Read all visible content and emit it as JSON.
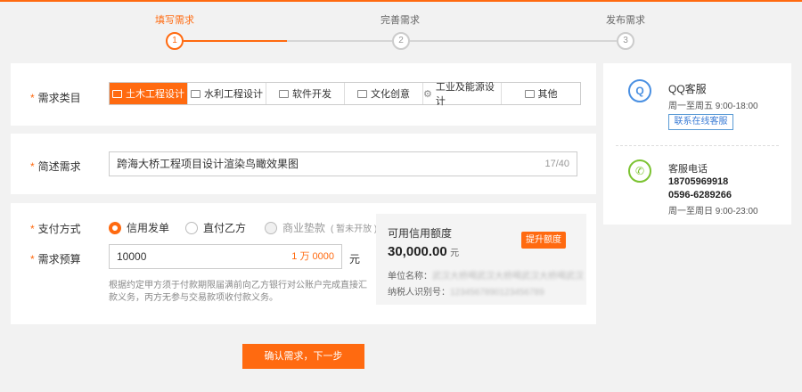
{
  "steps": [
    {
      "label": "填写需求",
      "num": "1"
    },
    {
      "label": "完善需求",
      "num": "2"
    },
    {
      "label": "发布需求",
      "num": "3"
    }
  ],
  "category": {
    "label": "需求类目",
    "items": [
      "土木工程设计",
      "水利工程设计",
      "软件开发",
      "文化创意",
      "工业及能源设计",
      "其他"
    ]
  },
  "brief": {
    "label": "简述需求",
    "value": "跨海大桥工程项目设计渲染鸟瞰效果图",
    "counter": "17/40"
  },
  "payment": {
    "label": "支付方式",
    "options": [
      "信用发单",
      "直付乙方",
      "商业垫款"
    ],
    "disabled_note": "( 暂未开放 )"
  },
  "budget": {
    "label": "需求预算",
    "value": "10000",
    "converted": "1 万 0000",
    "unit": "元",
    "hint": "根据约定甲方须于付款期限届满前向乙方银行对公账户完成直接汇款义务，丙方无参与交易款项收付款义务。"
  },
  "credit": {
    "title": "可用信用额度",
    "amount": "30,000.00",
    "unit": "元",
    "raise_button": "提升额度",
    "company_label": "单位名称：",
    "company_value": "武汉大桥喝武汉大桥喝武汉大桥喝武汉",
    "tax_label": "纳税人识别号：",
    "tax_value": "123456789012345678​9"
  },
  "submit_button": "确认需求，下一步",
  "support": {
    "qq_title": "QQ客服",
    "qq_hours": "周一至周五 9:00-18:00",
    "qq_button": "联系在线客服",
    "phone_title": "客服电话",
    "phone1": "18705969918",
    "phone2": "0596-6289266",
    "phone_hours": "周一至周日 9:00-23:00"
  },
  "colors": {
    "accent": "#ff6a10",
    "qq": "#4a90e2",
    "phone": "#7cc332"
  }
}
